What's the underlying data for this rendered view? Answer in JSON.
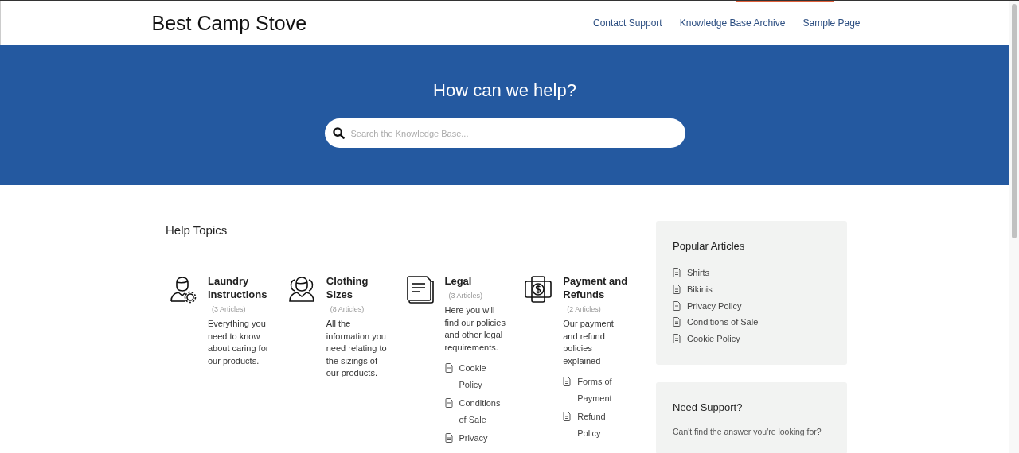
{
  "site": {
    "title": "Best Camp Stove"
  },
  "nav": [
    "Contact Support",
    "Knowledge Base Archive",
    "Sample Page"
  ],
  "hero": {
    "heading": "How can we help?",
    "search": {
      "placeholder": "Search the Knowledge Base..."
    }
  },
  "topics": {
    "heading": "Help Topics",
    "items": [
      {
        "title": "Laundry Instructions",
        "count": "(3 Articles)",
        "description": "Everything you need to know about caring for our products."
      },
      {
        "title": "Clothing Sizes",
        "count": "(8 Articles)",
        "description": "All the information you need relating to the sizings of our products."
      },
      {
        "title": "Legal",
        "count": "(3 Articles)",
        "description": "Here you will find our policies and other legal requirements.",
        "articles": [
          "Cookie Policy",
          "Conditions of Sale",
          "Privacy"
        ]
      },
      {
        "title": "Payment and Refunds",
        "count": "(2 Articles)",
        "description": "Our payment and refund policies explained",
        "articles": [
          "Forms of Payment",
          "Refund Policy"
        ]
      }
    ]
  },
  "popular": {
    "heading": "Popular Articles",
    "articles": [
      "Shirts",
      "Bikinis",
      "Privacy Policy",
      "Conditions of Sale",
      "Cookie Policy"
    ]
  },
  "support": {
    "heading": "Need Support?",
    "text": "Can't find the answer you're looking for?"
  }
}
